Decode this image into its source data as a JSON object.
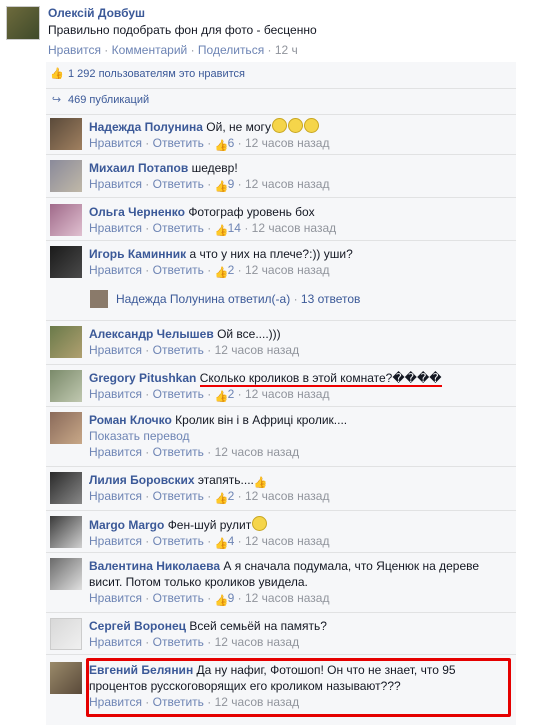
{
  "post": {
    "author": "Олексій Довбуш",
    "text": "Правильно подобрать фон для фото - бесценно",
    "actions": {
      "like": "Нравится",
      "comment": "Комментарий",
      "share": "Поделиться",
      "time": "12 ч"
    }
  },
  "summary": {
    "likes": "1 292 пользователям это нравится",
    "shares": "469 публикаций"
  },
  "labels": {
    "like": "Нравится",
    "reply": "Ответить",
    "translate": "Показать перевод"
  },
  "comments": [
    {
      "author": "Надежда Полунина",
      "text": "Ой, не могу",
      "likes": "6",
      "time": "12 часов назад"
    },
    {
      "author": "Михаил Потапов",
      "text": "шедевр!",
      "likes": "9",
      "time": "12 часов назад"
    },
    {
      "author": "Ольга Черненко",
      "text": "Фотограф уровень бох",
      "likes": "14",
      "time": "12 часов назад"
    },
    {
      "author": "Игорь Каминник",
      "text": "а что у них на плече?:)) уши?",
      "likes": "2",
      "time": "12 часов назад"
    },
    {
      "author": "Александр Челышев",
      "text": "Ой все....)))",
      "likes": "",
      "time": "12 часов назад"
    },
    {
      "author": "Gregory Pitushkan",
      "text": "Сколько кроликов в этой комнате?����",
      "likes": "2",
      "time": "12 часов назад"
    },
    {
      "author": "Роман Клочко",
      "text": "Кролик він і в Африці кролик....",
      "likes": "",
      "time": "12 часов назад"
    },
    {
      "author": "Лилия Боровских",
      "text": "этапять....",
      "likes": "2",
      "time": "12 часов назад"
    },
    {
      "author": "Margo Margo",
      "text": "Фен-шуй рулит",
      "likes": "4",
      "time": "12 часов назад"
    },
    {
      "author": "Валентина Николаева",
      "text": "А я сначала подумала, что Яценюк на дереве висит. Потом только кроликов увидела.",
      "likes": "9",
      "time": "12 часов назад"
    },
    {
      "author": "Сергей Воронец",
      "text": "Всей семьёй на память?",
      "likes": "",
      "time": "12 часов назад"
    },
    {
      "author": "Евгений Белянин",
      "text": "Да ну нафиг, Фотошоп! Он что не знает, что 95 процентов русскоговорящих его кроликом называют???",
      "likes": "",
      "time": "12 часов назад"
    }
  ],
  "reply_summary": {
    "author": "Надежда Полунина",
    "action": "ответил(-а)",
    "count": "13 ответов"
  }
}
